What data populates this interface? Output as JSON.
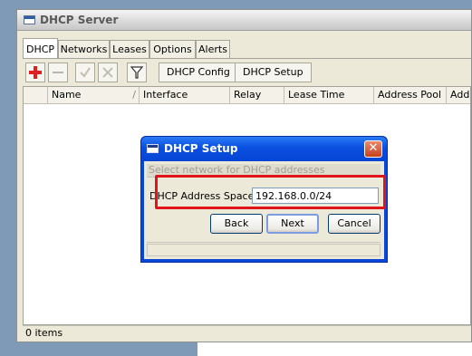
{
  "window": {
    "title": "DHCP Server"
  },
  "tabs": [
    {
      "label": "DHCP"
    },
    {
      "label": "Networks"
    },
    {
      "label": "Leases"
    },
    {
      "label": "Options"
    },
    {
      "label": "Alerts"
    }
  ],
  "toolbar": {
    "add_icon": "plus-icon",
    "remove_icon": "minus-icon",
    "enable_icon": "check-icon",
    "disable_icon": "cross-icon",
    "filter_icon": "filter-icon",
    "config_label": "DHCP Config",
    "setup_label": "DHCP Setup"
  },
  "table": {
    "columns": [
      "Name",
      "Interface",
      "Relay",
      "Lease Time",
      "Address Pool",
      "Add A"
    ],
    "sort_indicator": "/",
    "rows": []
  },
  "status": {
    "text": "0 items"
  },
  "dialog": {
    "title": "DHCP Setup",
    "subtitle": "Select network for DHCP addresses",
    "field_label": "DHCP Address Space:",
    "field_value": "192.168.0.0/24",
    "back_label": "Back",
    "next_label": "Next",
    "cancel_label": "Cancel",
    "close_label": "✕"
  },
  "colors": {
    "highlight": "#e0151a",
    "dialog_title": "#0a46d8",
    "add_icon": "#e02020"
  }
}
